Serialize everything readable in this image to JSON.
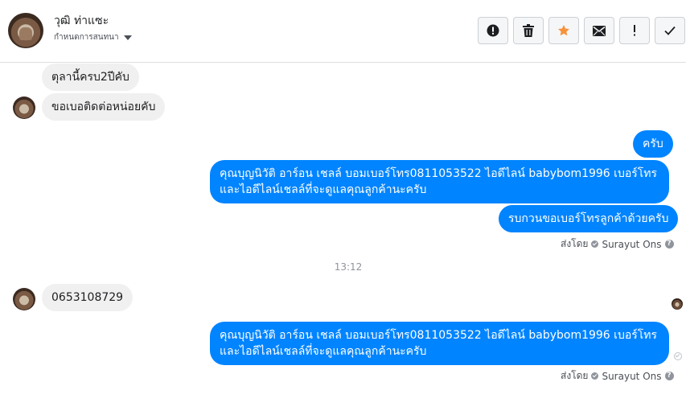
{
  "header": {
    "contact_name": "วุฒิ ท่าแซะ",
    "conversation_settings_label": "กำหนดการสนทนา"
  },
  "toolbar": {
    "buttons": [
      {
        "name": "report",
        "icon": "alert-circle-icon"
      },
      {
        "name": "delete",
        "icon": "trash-icon"
      },
      {
        "name": "star",
        "icon": "star-icon",
        "color": "#f7923b"
      },
      {
        "name": "mark-unread",
        "icon": "envelope-icon"
      },
      {
        "name": "important",
        "icon": "exclamation-icon"
      },
      {
        "name": "done",
        "icon": "check-icon"
      }
    ]
  },
  "messages": {
    "m1": "ตุลานี้ครบ2ปีคับ",
    "m2": "ขอเบอติดต่อหน่อยคับ",
    "m3": "ครับ",
    "m4": "คุณบุญนิวัติ อาร์อน เชลล์ บอมเบอร์โทร0811053522 ไอดีไลน์ babybom1996  เบอร์โทรและไอดีไลน์เชลล์ที่จะดูแลคุณลูกค้านะครับ",
    "m5": "รบกวนขอเบอร์โทรลูกค้าด้วยครับ",
    "sent_by_1": "ส่งโดย",
    "sender_1": "Surayut Ons",
    "timestamp": "13:12",
    "m6": "0653108729",
    "m7": "คุณบุญนิวัติ อาร์อน เชลล์ บอมเบอร์โทร0811053522 ไอดีไลน์ babybom1996  เบอร์โทรและไอดีไลน์เชลล์ที่จะดูแลคุณลูกค้านะครับ",
    "sent_by_2": "ส่งโดย",
    "sender_2": "Surayut Ons"
  },
  "colors": {
    "outgoing_bubble": "#0084ff",
    "incoming_bubble": "#f1f0f0"
  }
}
